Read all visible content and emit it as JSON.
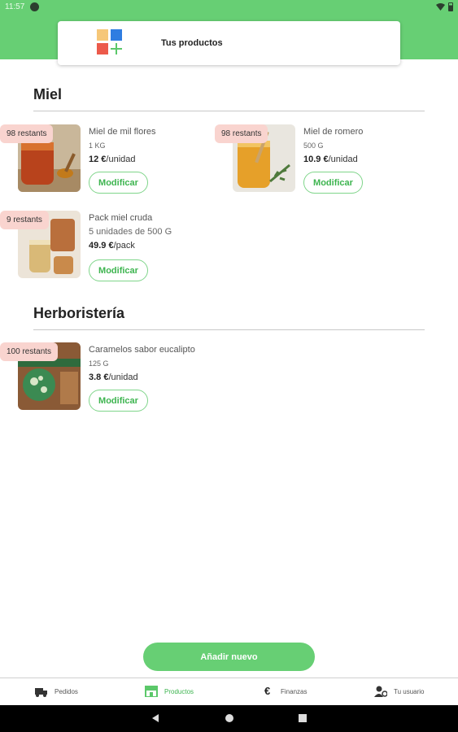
{
  "status_bar": {
    "time": "11:57"
  },
  "header": {
    "title": "Tus productos",
    "logo_icon": "grid-plus-logo-icon"
  },
  "sections": [
    {
      "title": "Miel",
      "products": [
        {
          "stock": "98 restants",
          "name": "Miel de mil flores",
          "size": "1 KG",
          "price": "12 €",
          "unit": "/unidad",
          "button": "Modificar"
        },
        {
          "stock": "98 restants",
          "name": "Miel de romero",
          "size": "500 G",
          "price": "10.9 €",
          "unit": "/unidad",
          "button": "Modificar"
        },
        {
          "stock": "9 restants",
          "name": "Pack miel cruda",
          "size": "5 unidades de 500 G",
          "price": "49.9 €",
          "unit": "/pack",
          "button": "Modificar"
        }
      ]
    },
    {
      "title": "Herboristería",
      "products": [
        {
          "stock": "100 restants",
          "name": "Caramelos sabor eucalipto",
          "size": "125 G",
          "price": "3.8 €",
          "unit": "/unidad",
          "button": "Modificar"
        }
      ]
    }
  ],
  "add_button": "Añadir nuevo",
  "bottom_nav": [
    {
      "label": "Pedidos",
      "icon": "delivery-icon"
    },
    {
      "label": "Productos",
      "icon": "store-icon"
    },
    {
      "label": "Finanzas",
      "icon": "euro-icon"
    },
    {
      "label": "Tu usuario",
      "icon": "user-settings-icon"
    }
  ],
  "colors": {
    "brand_green": "#67cf74",
    "badge_pink": "#f9d4cf",
    "button_green_text": "#3db44f"
  }
}
